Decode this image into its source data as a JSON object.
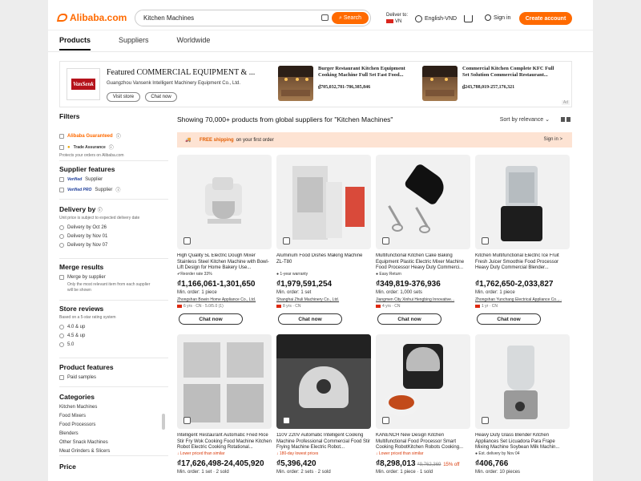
{
  "header": {
    "logo": "Alibaba.com",
    "search_value": "Kitchen Machines",
    "search_button": "Search",
    "deliver_label": "Deliver to:",
    "deliver_country": "VN",
    "language": "English-VND",
    "sign_in": "Sign in",
    "create_account": "Create account"
  },
  "tabs": [
    "Products",
    "Suppliers",
    "Worldwide"
  ],
  "banner": {
    "company_title": "Featured COMMERCIAL EQUIPMENT & ...",
    "company_name": "Guangzhou Vansenk Intelligent Machinery Equipment Co., Ltd.",
    "logo_text": "VanSenk",
    "visit_store": "Visit store",
    "chat_now": "Chat now",
    "ad_tag": "Ad",
    "promos": [
      {
        "title": "Burger Restaurant Kitchen Equipment Cooking Machine Full Set Fast Food...",
        "price": "₫705,032,781-786,385,846"
      },
      {
        "title": "Commercial Kitchen Complete KFC Full Set Solution Commercial Restaurant...",
        "price": "₫243,788,019-257,176,321"
      }
    ]
  },
  "filters": {
    "title": "Filters",
    "alibaba_guaranteed": "Alibaba Guaranteed",
    "trade_assurance": "Trade Assurance",
    "protect_note": "Protects your orders on Alibaba.com",
    "supplier_features": {
      "title": "Supplier features",
      "items": [
        "Supplier",
        "Supplier"
      ],
      "badges": [
        "Verified",
        "Verified PRO"
      ]
    },
    "delivery": {
      "title": "Delivery by",
      "note": "Unit price is subject to expected delivery date",
      "options": [
        "Delivery by Oct 26",
        "Delivery by Nov 01",
        "Delivery by Nov 07"
      ]
    },
    "merge": {
      "title": "Merge results",
      "option": "Merge by supplier",
      "note": "Only the most relevant item from each supplier will be shown"
    },
    "reviews": {
      "title": "Store reviews",
      "note": "Based on a 5-star rating system",
      "options": [
        "4.0 & up",
        "4.5 & up",
        "5.0"
      ]
    },
    "product_features": {
      "title": "Product features",
      "option": "Paid samples"
    },
    "categories": {
      "title": "Categories",
      "items": [
        "Kitchen Machines",
        "Food Mixers",
        "Food Processors",
        "Blenders",
        "Other Snack Machines",
        "Meat Grinders & Slicers"
      ]
    },
    "price_title": "Price"
  },
  "results": {
    "count_text": "Showing 70,000+ products from global suppliers for \"Kitchen Machines\"",
    "sort": "Sort by relevance",
    "ship_free": "FREE shipping",
    "ship_rest": "on your first order",
    "ship_sign": "Sign in >"
  },
  "products": [
    {
      "title": "High Quality 5L Electric Dough Mixer Stainless Steel Kitchen Machine with Bowl-Lift Design for Home Bakery Use...",
      "tag": "✔Reorder rate 33%",
      "price": "₫1,166,061-1,301,650",
      "moq": "Min. order: 1 piece",
      "supplier": "Zhongshan Bowin Home Appliance Co., Ltd.",
      "meta": "6 yrs · CN · 5.0/5.0 (1)",
      "chat": "Chat now"
    },
    {
      "title": "Aluminum Food Dishes Making Machine ZL-T80",
      "tag": "● 1-year warranty",
      "price": "₫1,979,591,254",
      "moq": "Min. order: 1 set",
      "supplier": "Shanghai Zhuli Machinery Co., Ltd.",
      "meta": "8 yrs · CN",
      "chat": "Chat now"
    },
    {
      "title": "Multifunctional Kitchen Cake Baking Equipment Plastic Electric Mixer Machine Food Processor Heavy Duty Commerci...",
      "tag": "● Easy Return",
      "price": "₫349,819-376,936",
      "moq": "Min. order: 1,000 sets",
      "supplier": "Jiangmen City Xinhui Hengbing Innovative...",
      "meta": "4 yrs · CN",
      "chat": "Chat now"
    },
    {
      "title": "Kitchen Multifunctional Electric Ice Fruit Fresh Juicer Smoothie Food Processor Heavy Duty Commercial Blender...",
      "tag": "",
      "price": "₫1,762,650-2,033,827",
      "moq": "Min. order: 1 piece",
      "supplier": "Zhongshan Yunchang Electrical Appliance Co.,...",
      "meta": "1 yr · CN",
      "chat": "Chat now"
    },
    {
      "title": "Intelligent Restaurant Automatic Fried Rice Stir Fry Wok Cooking Food Machine Kitchen Robot Electric Cooking Rotational...",
      "tag": "↓ Lower priced than similar",
      "price": "₫17,626,498-24,405,920",
      "moq": "Min. order: 1 set · 2 sold",
      "supplier": "",
      "meta": "",
      "chat": ""
    },
    {
      "title": "110V 220V Automatic Intelligent Cooking Machine Professional Commercial Food Stir Frying Machine Electric Robot...",
      "tag": "↓ 180-day lowest prices",
      "price": "₫5,396,420",
      "moq": "Min. order: 2 sets · 2 sold",
      "supplier": "",
      "meta": "",
      "chat": ""
    },
    {
      "title": "KANENCH New Design Kitchen Multifunctional Food Processor Smart Cooking RobotKitchen Robots Cooking...",
      "tag": "↓ Lower priced than similar",
      "price": "₫8,298,013",
      "strike": "₫9,762,369",
      "off": "15% off",
      "moq": "Min. order: 1 piece · 1 sold",
      "supplier": "",
      "meta": "",
      "chat": ""
    },
    {
      "title": "Heavy Duty Glass Blender Kitchen Appliances Set Licuadora Para Frape Mixing Machine Soybean Milk Machin...",
      "tag": "● Est. delivery by Nov 04",
      "price": "₫406,766",
      "moq": "Min. order: 10 pieces",
      "supplier": "",
      "meta": "",
      "chat": ""
    }
  ]
}
